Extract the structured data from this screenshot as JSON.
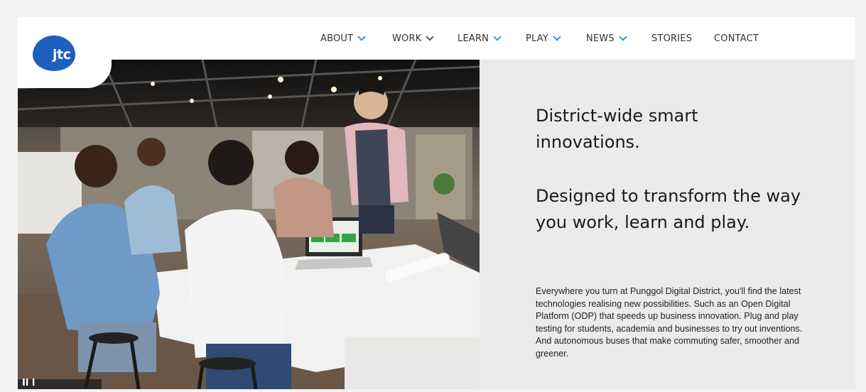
{
  "brand": {
    "logo_text": "jtc",
    "color": "#1d5fbf"
  },
  "nav": {
    "items": [
      {
        "label": "ABOUT",
        "has_dropdown": true
      },
      {
        "label": "WORK",
        "has_dropdown": true
      },
      {
        "label": "LEARN",
        "has_dropdown": true
      },
      {
        "label": "PLAY",
        "has_dropdown": true
      },
      {
        "label": "NEWS",
        "has_dropdown": true
      },
      {
        "label": "STORIES",
        "has_dropdown": false
      },
      {
        "label": "CONTACT",
        "has_dropdown": false
      }
    ],
    "chevron_color": "#2d96d6"
  },
  "hero": {
    "headline_1": "District-wide smart innovations.",
    "headline_2": "Designed to transform the way you work, learn and play.",
    "body": "Everywhere you turn at Punggol Digital District, you'll find the latest technologies realising new possibilities. Such as an Open Digital Platform (ODP) that speeds up business innovation. Plug and play testing for students, academia and businesses to try out inventions. And autonomous buses that make commuting safer, smoother and greener.",
    "photo_caption": "Il l"
  }
}
